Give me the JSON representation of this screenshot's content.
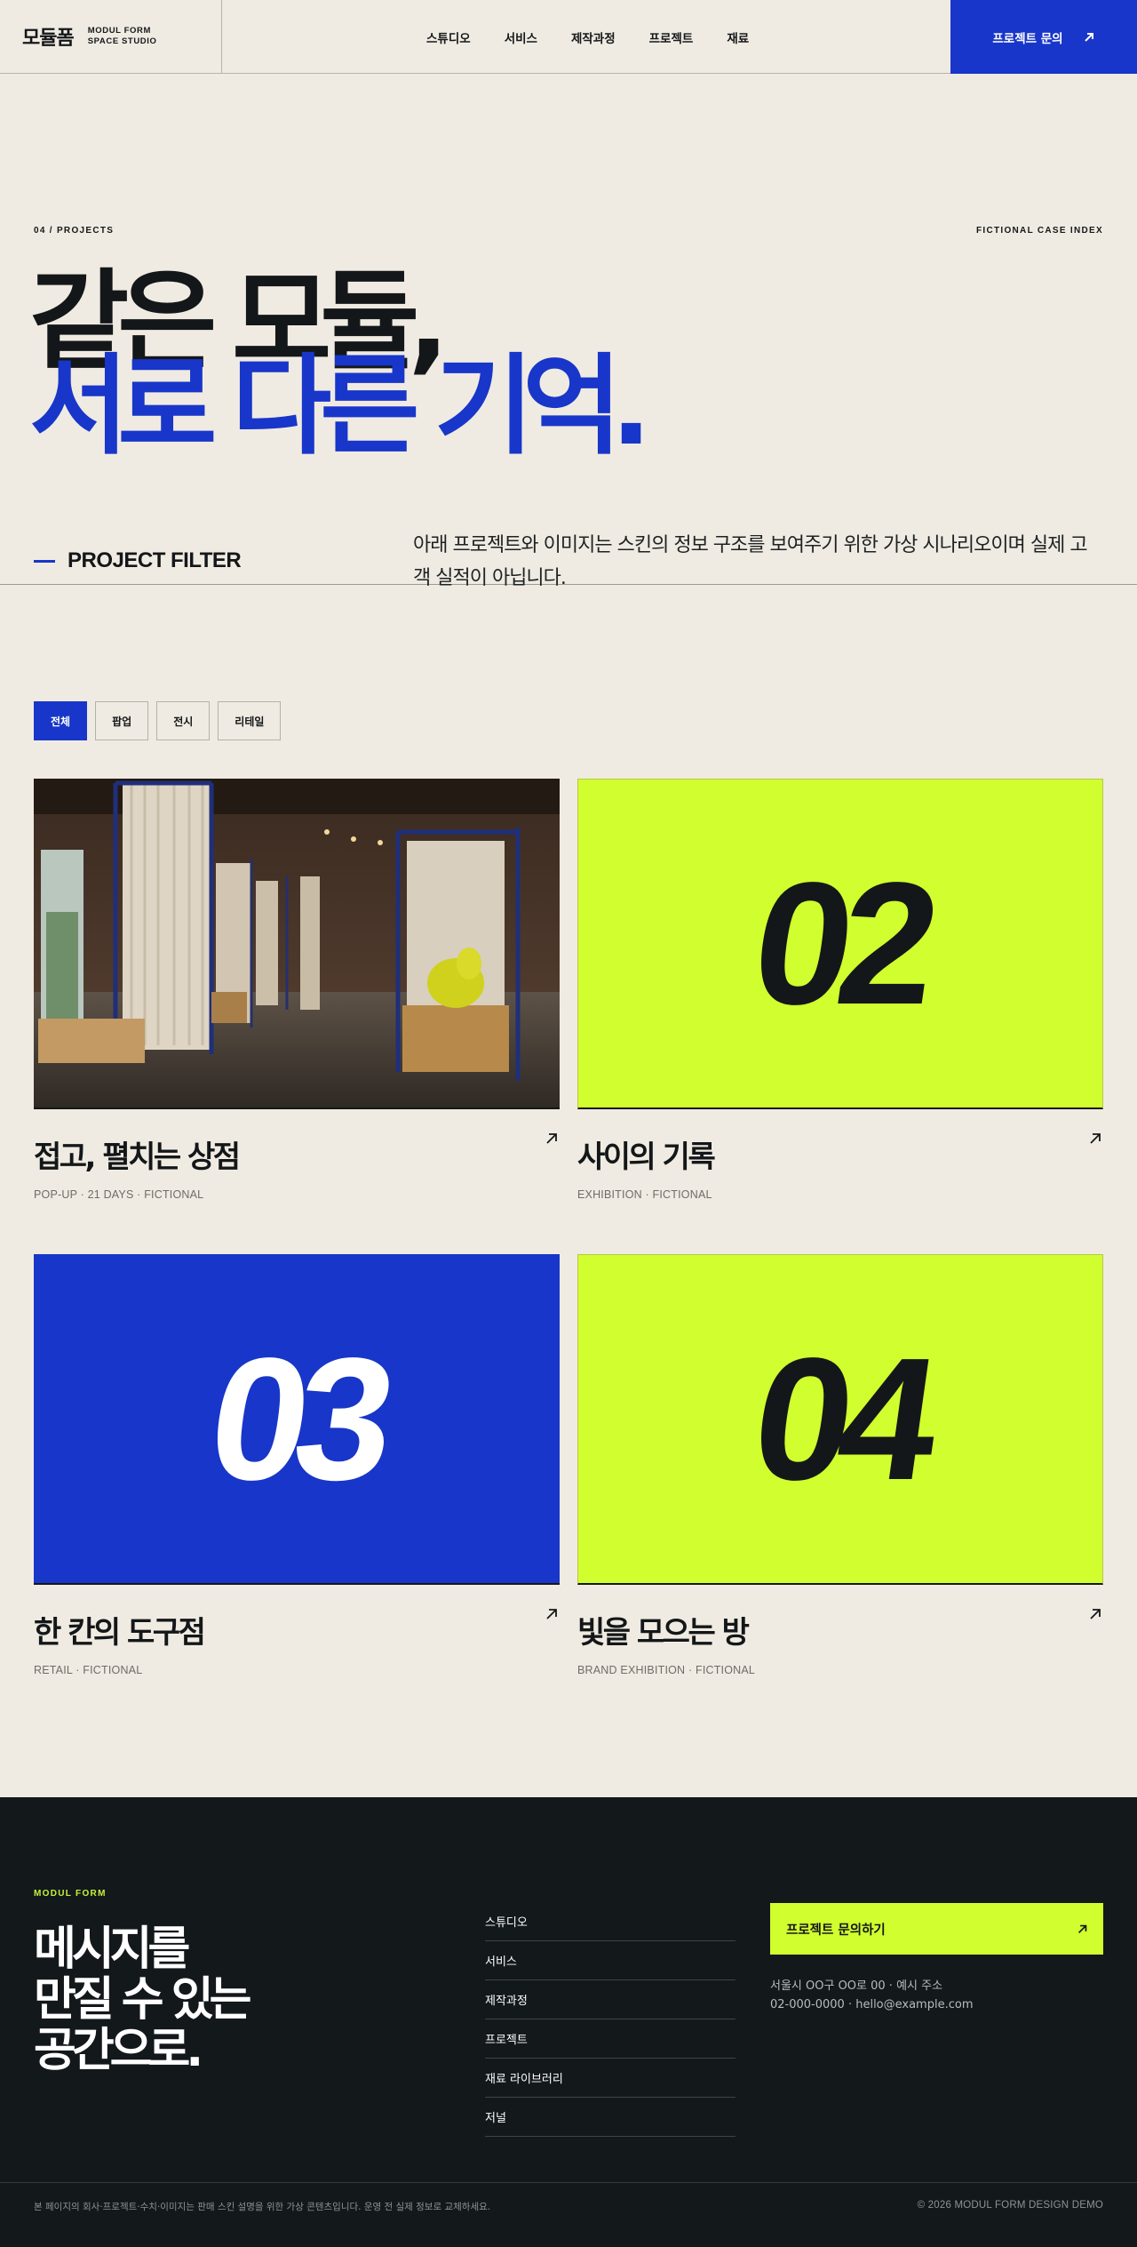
{
  "header": {
    "logo_ko": "모듈폼",
    "logo_en_1": "MODUL FORM",
    "logo_en_2": "SPACE STUDIO",
    "nav": [
      "스튜디오",
      "서비스",
      "제작과정",
      "프로젝트",
      "재료"
    ],
    "cta_label": "프로젝트 문의"
  },
  "hero": {
    "kicker": "04 / PROJECTS",
    "case_index": "FICTIONAL CASE INDEX",
    "headline_line1": "같은 모듈,",
    "headline_line2": "서로 다른 기억",
    "headline_dot": ".",
    "filter_label": "PROJECT FILTER",
    "description": "아래 프로젝트와 이미지는 스킨의 정보 구조를 보여주기 위한 가상 시나리오이며 실제 고객 실적이 아닙니다."
  },
  "filters": {
    "items": [
      "전체",
      "팝업",
      "전시",
      "리테일"
    ],
    "active": "전체"
  },
  "projects": [
    {
      "title": "접고, 펼치는 상점",
      "meta": "POP-UP · 21 DAYS · FICTIONAL",
      "media": "photo",
      "number": ""
    },
    {
      "title": "사이의 기록",
      "meta": "EXHIBITION · FICTIONAL",
      "media": "lime",
      "number": "02"
    },
    {
      "title": "한 칸의 도구점",
      "meta": "RETAIL · FICTIONAL",
      "media": "blue",
      "number": "03"
    },
    {
      "title": "빛을 모으는 방",
      "meta": "BRAND EXHIBITION · FICTIONAL",
      "media": "lime",
      "number": "04"
    }
  ],
  "footer": {
    "brand": "MODUL FORM",
    "slogan_1": "메시지를",
    "slogan_2": "만질 수 있는",
    "slogan_3": "공간으로.",
    "links": [
      "스튜디오",
      "서비스",
      "제작과정",
      "프로젝트",
      "재료 라이브러리",
      "저널"
    ],
    "cta_label": "프로젝트 문의하기",
    "address": "서울시 OO구 OO로 00 · 예시 주소",
    "contact": "02-000-0000 · hello@example.com",
    "note": "본 페이지의 회사·프로젝트·수치·이미지는 판매 스킨 설명을 위한 가상 콘텐츠입니다. 운영 전 실제 정보로 교체하세요.",
    "copyright": "© 2026 MODUL FORM DESIGN DEMO"
  },
  "colors": {
    "background": "#f0ebe2",
    "brand_blue": "#1836c9",
    "lime": "#d1fe2f",
    "ink": "#141719",
    "footer_bg": "#13181b"
  },
  "icons": {
    "cta_arrow": "arrow-up-right-icon",
    "card_arrow": "arrow-up-right-icon"
  }
}
